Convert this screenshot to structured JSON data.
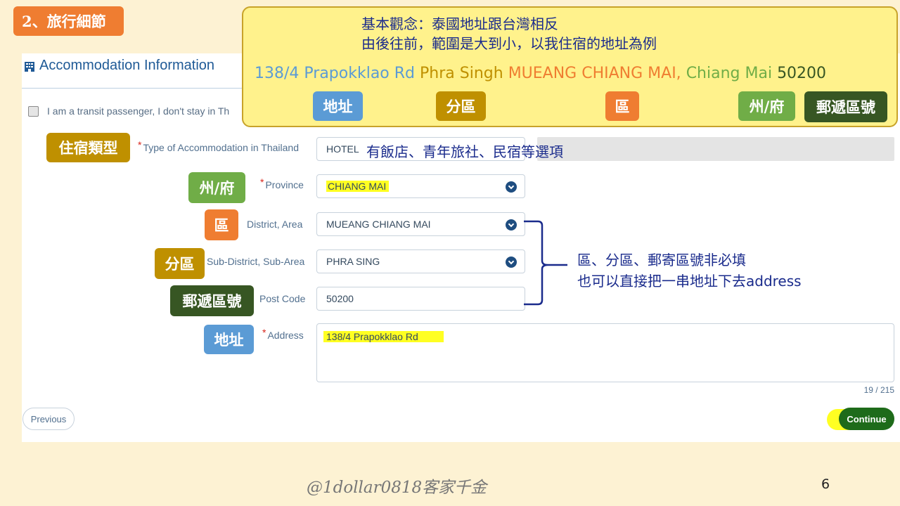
{
  "slide": {
    "section_badge": "2、旅行細節",
    "watermark": "@1dollar0818客家千金",
    "page_number": "6"
  },
  "form": {
    "title": "Accommodation Information",
    "title_icon": "building-icon",
    "transit_label": "I am a transit passenger, I don't stay in Th",
    "fields": {
      "type": {
        "label": "Type of Accommodation in Thailand",
        "required": "*",
        "value": "HOTEL"
      },
      "province": {
        "label": "Province",
        "required": "*",
        "value": "CHIANG MAI"
      },
      "district": {
        "label": "District, Area",
        "value": "MUEANG CHIANG MAI"
      },
      "subdistrict": {
        "label": "Sub-District, Sub-Area",
        "value": "PHRA SING"
      },
      "postcode": {
        "label": "Post Code",
        "value": "50200"
      },
      "address": {
        "label": "Address",
        "required": "*",
        "value": "138/4 Prapokklao Rd",
        "char_count": "19 / 215"
      }
    },
    "previous_label": "Previous",
    "continue_label": "Continue"
  },
  "callout": {
    "line1": "基本觀念：泰國地址跟台灣相反",
    "line2": "由後往前，範圍是大到小，以我住宿的地址為例",
    "address_parts": {
      "street": "138/4 Prapokklao Rd",
      "subdistrict": "Phra Singh",
      "district": "MUEANG CHIANG MAI,",
      "province": "Chiang Mai",
      "postcode": "50200"
    },
    "tags": {
      "address": "地址",
      "subdistrict": "分區",
      "district": "區",
      "province": "州/府",
      "postcode": "郵遞區號"
    }
  },
  "annotations": {
    "type_tag": "住宿類型",
    "type_note": "有飯店、青年旅社、民宿等選項",
    "province_tag": "州/府",
    "district_tag": "區",
    "subdistrict_tag": "分區",
    "postcode_tag": "郵遞區號",
    "address_tag": "地址",
    "optional_note_line1": "區、分區、郵寄區號非必填",
    "optional_note_line2": "也可以直接把一串地址下去address"
  },
  "colors": {
    "orange": "#ef7d31",
    "blue_tag": "#5b9bd5",
    "gold_tag": "#bf9000",
    "green_tag": "#70ad47",
    "dark_green_tag": "#375623",
    "continue_green": "#1e6b1a",
    "highlight_yellow": "#ffff22",
    "callout_bg": "#fff28c",
    "note_navy": "#1a2b8c"
  }
}
